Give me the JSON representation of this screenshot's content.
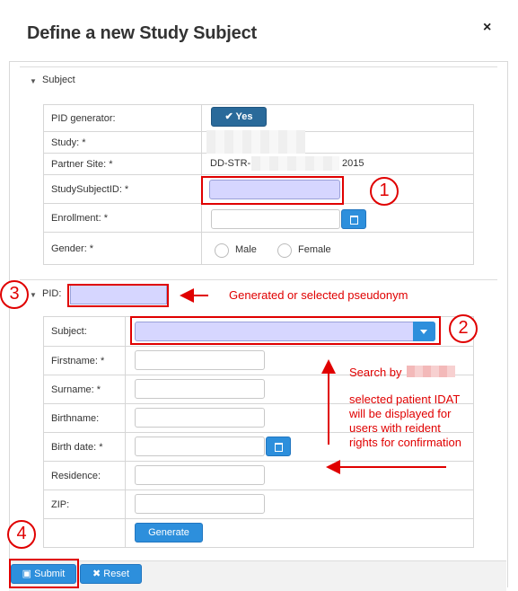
{
  "dialog": {
    "title": "Define a new Study Subject",
    "close_glyph": "×"
  },
  "subject_section": {
    "label": "Subject",
    "rows": {
      "pid_generator": {
        "label": "PID generator:",
        "toggle": "Yes"
      },
      "study": {
        "label": "Study: *"
      },
      "partner_site": {
        "label": "Partner Site: *",
        "value_prefix": "DD-STR-",
        "value_suffix": "2015"
      },
      "study_subject_id": {
        "label": "StudySubjectID: *"
      },
      "enrollment": {
        "label": "Enrollment: *"
      },
      "gender": {
        "label": "Gender: *",
        "male": "Male",
        "female": "Female"
      }
    }
  },
  "pid_section": {
    "label": "PID:",
    "rows": {
      "subject": {
        "label": "Subject:"
      },
      "firstname": {
        "label": "Firstname: *"
      },
      "surname": {
        "label": "Surname: *"
      },
      "birthname": {
        "label": "Birthname:"
      },
      "birth_date": {
        "label": "Birth date: *"
      },
      "residence": {
        "label": "Residence:"
      },
      "zip": {
        "label": "ZIP:"
      }
    },
    "generate_label": "Generate"
  },
  "footer": {
    "submit": "Submit",
    "reset": "Reset"
  },
  "annotations": {
    "n1": "1",
    "n2": "2",
    "n3": "3",
    "n4": "4",
    "pid_note": "Generated or selected pseudonym",
    "search_by": "Search by",
    "idat_note_1": "selected patient IDAT",
    "idat_note_2": "will be displayed for",
    "idat_note_3": "users with reident",
    "idat_note_4": "rights for confirmation"
  },
  "colors": {
    "annotation_red": "#e00000",
    "primary_blue": "#2d8fdc",
    "highlight_field": "#d6d6ff"
  }
}
